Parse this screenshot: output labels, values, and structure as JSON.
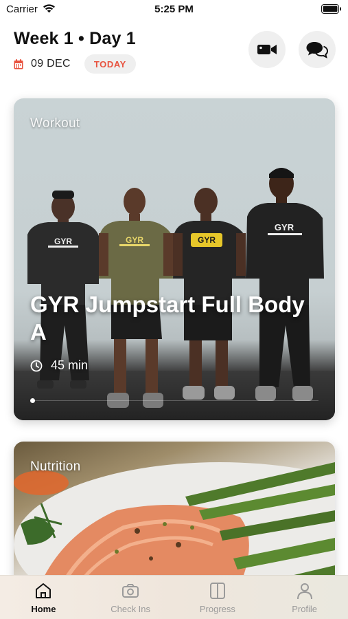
{
  "status_bar": {
    "carrier": "Carrier",
    "time": "5:25 PM"
  },
  "header": {
    "title": "Week 1 • Day 1",
    "date": "09 DEC",
    "today_label": "TODAY"
  },
  "cards": {
    "workout": {
      "label": "Workout",
      "title": "GYR Jumpstart Full Body A",
      "duration": "45 min",
      "shirt_text": "GYR"
    },
    "nutrition": {
      "label": "Nutrition"
    }
  },
  "tabs": [
    {
      "label": "Home",
      "icon": "home-icon",
      "active": true
    },
    {
      "label": "Check Ins",
      "icon": "camera-icon",
      "active": false
    },
    {
      "label": "Progress",
      "icon": "split-panel-icon",
      "active": false
    },
    {
      "label": "Profile",
      "icon": "person-icon",
      "active": false
    }
  ],
  "colors": {
    "accent": "#e8533f",
    "pill_bg": "#efefef",
    "tab_bar_bg": "#f1e9e0"
  }
}
